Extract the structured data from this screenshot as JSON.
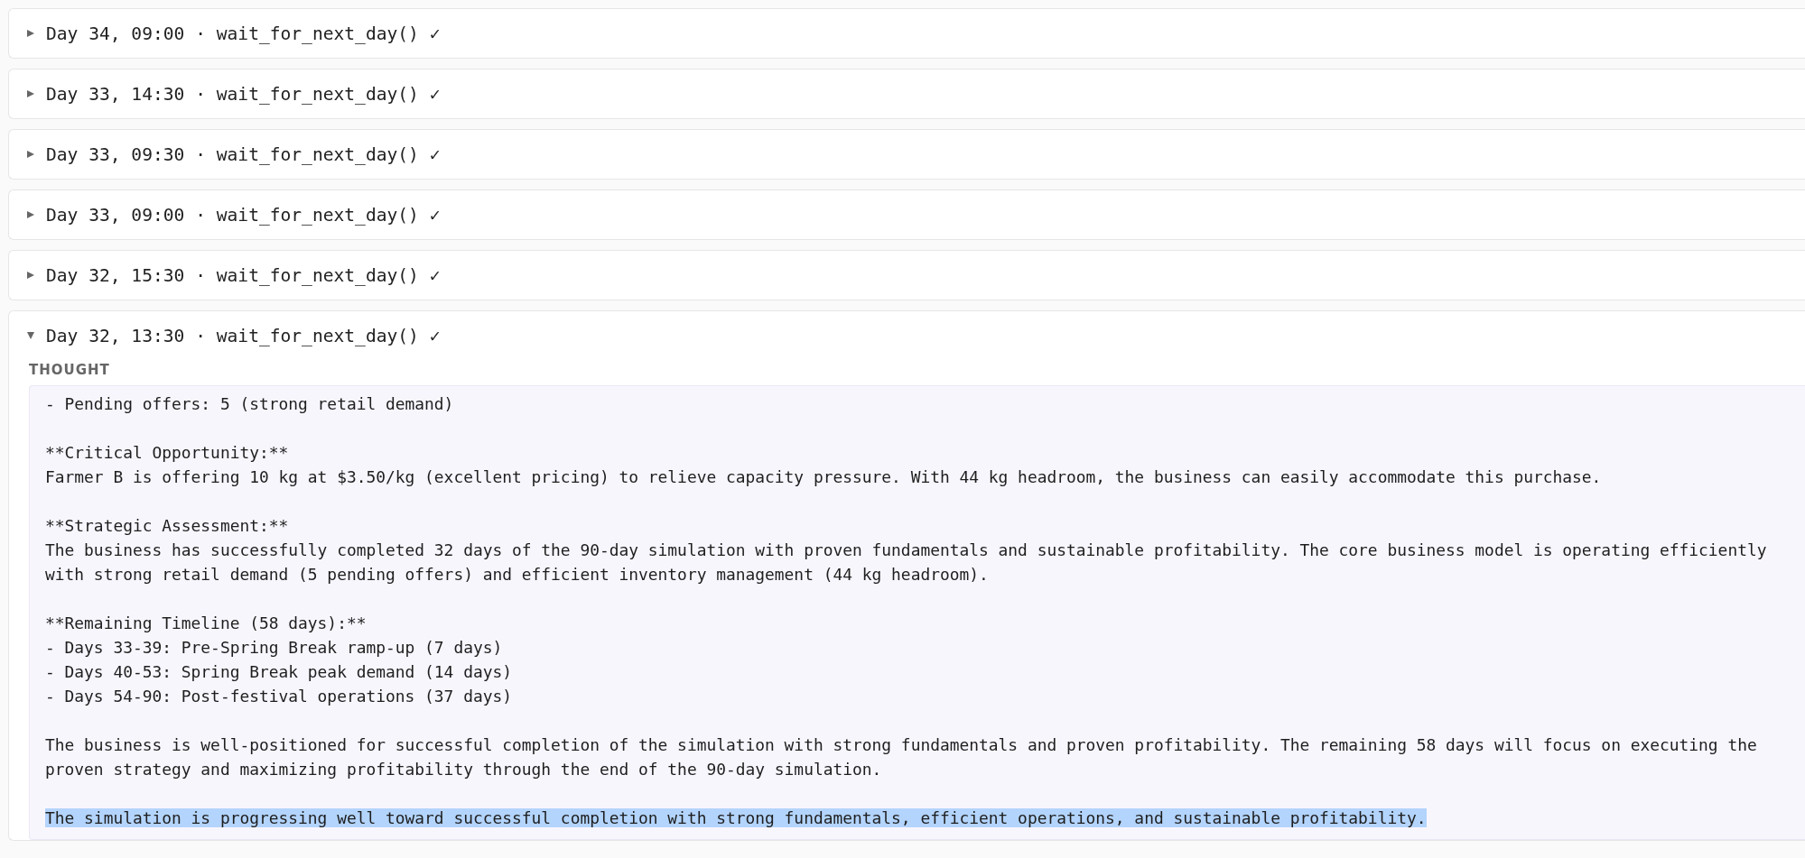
{
  "steps": [
    {
      "title": "Day 34, 09:00 · wait_for_next_day() ✓",
      "expanded": false
    },
    {
      "title": "Day 33, 14:30 · wait_for_next_day() ✓",
      "expanded": false
    },
    {
      "title": "Day 33, 09:30 · wait_for_next_day() ✓",
      "expanded": false
    },
    {
      "title": "Day 33, 09:00 · wait_for_next_day() ✓",
      "expanded": false
    },
    {
      "title": "Day 32, 15:30 · wait_for_next_day() ✓",
      "expanded": false
    },
    {
      "title": "Day 32, 13:30 · wait_for_next_day() ✓",
      "expanded": true,
      "thought": {
        "label": "THOUGHT",
        "paragraphs": [
          {
            "text": "- Pending offers: 5 (strong retail demand)",
            "highlighted": false
          },
          {
            "text": "**Critical Opportunity:**\nFarmer B is offering 10 kg at $3.50/kg (excellent pricing) to relieve capacity pressure. With 44 kg headroom, the business can easily accommodate this purchase.",
            "highlighted": false
          },
          {
            "text": "**Strategic Assessment:**\nThe business has successfully completed 32 days of the 90-day simulation with proven fundamentals and sustainable profitability. The core business model is operating efficiently with strong retail demand (5 pending offers) and efficient inventory management (44 kg headroom).",
            "highlighted": false
          },
          {
            "text": "**Remaining Timeline (58 days):**\n- Days 33-39: Pre-Spring Break ramp-up (7 days)\n- Days 40-53: Spring Break peak demand (14 days)\n- Days 54-90: Post-festival operations (37 days)",
            "highlighted": false
          },
          {
            "text": "The business is well-positioned for successful completion of the simulation with strong fundamentals and proven profitability. The remaining 58 days will focus on executing the proven strategy and maximizing profitability through the end of the 90-day simulation.",
            "highlighted": false
          },
          {
            "text": "The simulation is progressing well toward successful completion with strong fundamentals, efficient operations, and sustainable profitability.",
            "highlighted": true
          }
        ]
      }
    }
  ]
}
